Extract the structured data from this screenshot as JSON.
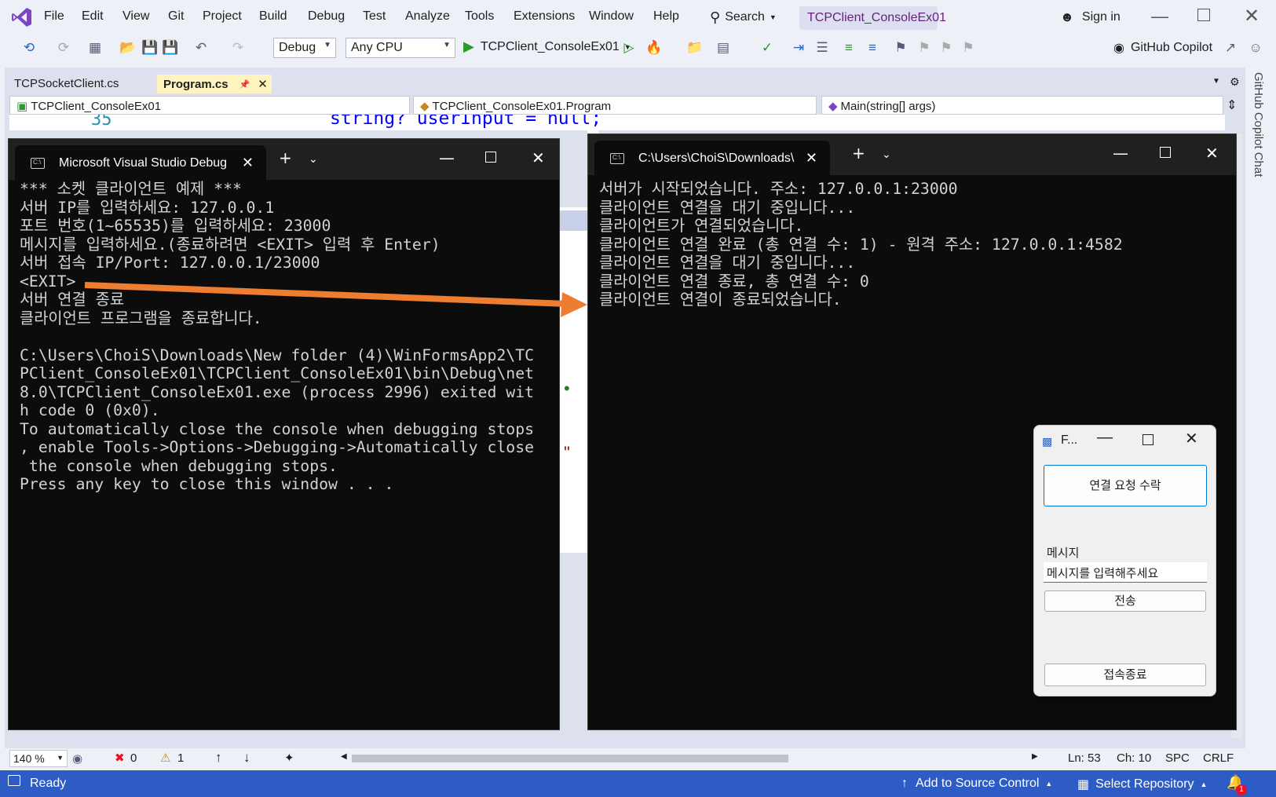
{
  "app": {
    "menu": [
      "File",
      "Edit",
      "View",
      "Git",
      "Project",
      "Build",
      "Debug",
      "Test",
      "Analyze",
      "Tools",
      "Extensions",
      "Window",
      "Help"
    ],
    "search_label": "Search",
    "solution_title": "TCPClient_ConsoleEx01",
    "sign_in": "Sign in",
    "accent": "#68217a"
  },
  "toolbar": {
    "config": "Debug",
    "platform": "Any CPU",
    "start_target": "TCPClient_ConsoleEx01",
    "copilot": "GitHub Copilot"
  },
  "editor": {
    "tabs": [
      {
        "label": "TCPSocketClient.cs",
        "active": false
      },
      {
        "label": "Program.cs",
        "active": true
      }
    ],
    "nav_project": "TCPClient_ConsoleEx01",
    "nav_class": "TCPClient_ConsoleEx01.Program",
    "nav_member": "Main(string[] args)",
    "line_number": "35",
    "code_visible": "string? userInput = null;",
    "side_panel_label": "GitHub Copilot Chat"
  },
  "client_console": {
    "tab_title": "Microsoft Visual Studio Debug",
    "lines": [
      "*** 소켓 클라이언트 예제 ***",
      "서버 IP를 입력하세요: 127.0.0.1",
      "포트 번호(1~65535)를 입력하세요: 23000",
      "메시지를 입력하세요.(종료하려면 <EXIT> 입력 후 Enter)",
      "서버 접속 IP/Port: 127.0.0.1/23000",
      "<EXIT>",
      "서버 연결 종료",
      "클라이언트 프로그램을 종료합니다.",
      "",
      "C:\\Users\\ChoiS\\Downloads\\New folder (4)\\WinFormsApp2\\TC",
      "PClient_ConsoleEx01\\TCPClient_ConsoleEx01\\bin\\Debug\\net",
      "8.0\\TCPClient_ConsoleEx01.exe (process 2996) exited wit",
      "h code 0 (0x0).",
      "To automatically close the console when debugging stops",
      ", enable Tools->Options->Debugging->Automatically close",
      " the console when debugging stops.",
      "Press any key to close this window . . ."
    ]
  },
  "server_console": {
    "tab_title": "C:\\Users\\ChoiS\\Downloads\\",
    "lines": [
      "서버가 시작되었습니다. 주소: 127.0.0.1:23000",
      "클라이언트 연결을 대기 중입니다...",
      "클라이언트가 연결되었습니다.",
      "클라이언트 연결 완료 (총 연결 수: 1) - 원격 주소: 127.0.0.1:4582",
      "클라이언트 연결을 대기 중입니다...",
      "클라이언트 연결 종료, 총 연결 수: 0",
      "클라이언트 연결이 종료되었습니다."
    ]
  },
  "form": {
    "title": "F...",
    "accept_button": "연결 요청 수락",
    "message_label": "메시지",
    "message_value": "메시지를 입력해주세요",
    "send_button": "전송",
    "disconnect_button": "접속종료"
  },
  "status": {
    "zoom": "140 %",
    "errors": "0",
    "warnings": "1",
    "line": "Ln: 53",
    "col": "Ch: 10",
    "spacing": "SPC",
    "eol": "CRLF",
    "ready": "Ready",
    "source_control": "Add to Source Control",
    "repository": "Select Repository",
    "notifications": "1",
    "notif_color": "#e81123"
  }
}
